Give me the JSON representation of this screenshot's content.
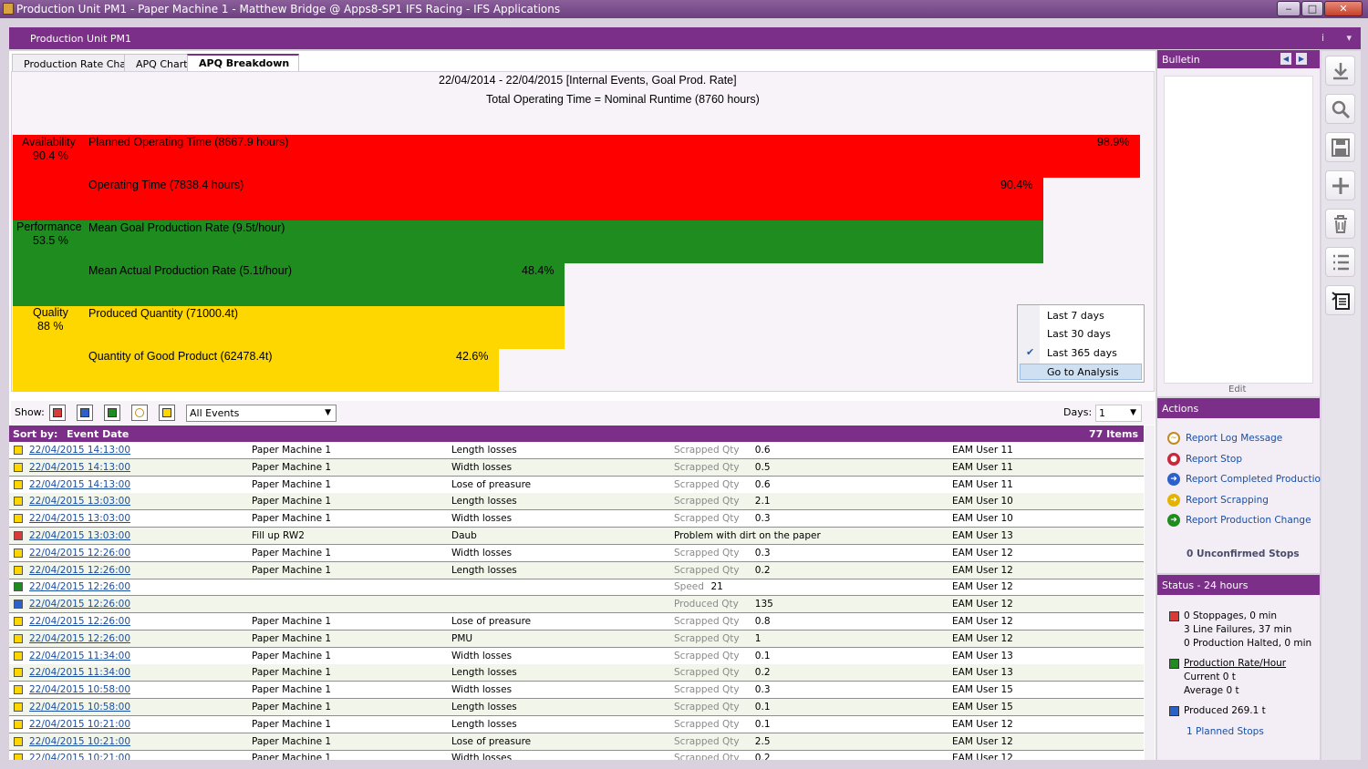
{
  "window": {
    "title": "Production Unit PM1 - Paper Machine 1 - Matthew Bridge @ Apps8-SP1 IFS Racing - IFS Applications",
    "min": "‒",
    "max": "□",
    "close": "✕"
  },
  "header": {
    "title": "Production Unit PM1",
    "info": "i",
    "pin": "▾"
  },
  "tabs": [
    {
      "label": "Production Rate Chart"
    },
    {
      "label": "APQ Chart"
    },
    {
      "label": "APQ Breakdown"
    }
  ],
  "apq": {
    "period": "22/04/2014 - 22/04/2015 [Internal Events, Goal Prod. Rate]",
    "total": "Total Operating Time = Nominal Runtime (8760 hours)",
    "availability_label": "Availability",
    "availability_pct": "90.4 %",
    "performance_label": "Performance",
    "performance_pct": "53.5 %",
    "quality_label": "Quality",
    "quality_pct": "88 %",
    "bars": [
      {
        "label": "Planned Operating Time (8667.9 hours)",
        "pct": "98.9%",
        "fraction": 0.989
      },
      {
        "label": "Operating Time (7838.4 hours)",
        "pct": "90.4%",
        "fraction": 0.904
      },
      {
        "label": "Mean Goal Production Rate (9.5t/hour)",
        "pct": "",
        "fraction": 0.904
      },
      {
        "label": "Mean Actual Production Rate (5.1t/hour)",
        "pct": "48.4%",
        "fraction": 0.484
      },
      {
        "label": "Produced Quantity (71000.4t)",
        "pct": "",
        "fraction": 0.484
      },
      {
        "label": "Quantity of Good Product (62478.4t)",
        "pct": "42.6%",
        "fraction": 0.426
      }
    ],
    "colors": {
      "availability": "#ff0000",
      "performance": "#1e8c1e",
      "quality": "#ffd700"
    }
  },
  "menu": {
    "items": [
      "Last 7 days",
      "Last 30 days",
      "Last 365 days",
      "Go to Analysis"
    ],
    "checked": "✔"
  },
  "filter": {
    "show_label": "Show:",
    "events_value": "All Events",
    "days_label": "Days:",
    "days_value": "1",
    "arrow": "▼"
  },
  "grid": {
    "sort_label": "Sort by:",
    "sort_field": "Event Date",
    "count": "77 Items",
    "rows": [
      {
        "color": "#ffd700",
        "date": "22/04/2015 14:13:00",
        "unit": "Paper Machine 1",
        "reason": "Length losses",
        "qty_label": "Scrapped Qty",
        "qty": "0.6",
        "user": "EAM User 11"
      },
      {
        "color": "#ffd700",
        "date": "22/04/2015 14:13:00",
        "unit": "Paper Machine 1",
        "reason": "Width losses",
        "qty_label": "Scrapped Qty",
        "qty": "0.5",
        "user": "EAM User 11"
      },
      {
        "color": "#ffd700",
        "date": "22/04/2015 14:13:00",
        "unit": "Paper Machine 1",
        "reason": "Lose of preasure",
        "qty_label": "Scrapped Qty",
        "qty": "0.6",
        "user": "EAM User 11"
      },
      {
        "color": "#ffd700",
        "date": "22/04/2015 13:03:00",
        "unit": "Paper Machine 1",
        "reason": "Length losses",
        "qty_label": "Scrapped Qty",
        "qty": "2.1",
        "user": "EAM User 10"
      },
      {
        "color": "#ffd700",
        "date": "22/04/2015 13:03:00",
        "unit": "Paper Machine 1",
        "reason": "Width losses",
        "qty_label": "Scrapped Qty",
        "qty": "0.3",
        "user": "EAM User 10"
      },
      {
        "color": "#d93a3a",
        "date": "22/04/2015 13:03:00",
        "unit": "Fill up RW2",
        "reason": "Daub",
        "qty_label": "",
        "qty": "Problem with dirt on the paper",
        "user": "EAM User 13"
      },
      {
        "color": "#ffd700",
        "date": "22/04/2015 12:26:00",
        "unit": "Paper Machine 1",
        "reason": "Width losses",
        "qty_label": "Scrapped Qty",
        "qty": "0.3",
        "user": "EAM User 12"
      },
      {
        "color": "#ffd700",
        "date": "22/04/2015 12:26:00",
        "unit": "Paper Machine 1",
        "reason": "Length losses",
        "qty_label": "Scrapped Qty",
        "qty": "0.2",
        "user": "EAM User 12"
      },
      {
        "color": "#1e8c1e",
        "date": "22/04/2015 12:26:00",
        "unit": "",
        "reason": "",
        "qty_label": "Speed",
        "qty": "21",
        "user": "EAM User 12"
      },
      {
        "color": "#2a62c9",
        "date": "22/04/2015 12:26:00",
        "unit": "",
        "reason": "",
        "qty_label": "Produced Qty",
        "qty": "135",
        "user": "EAM User 12"
      },
      {
        "color": "#ffd700",
        "date": "22/04/2015 12:26:00",
        "unit": "Paper Machine 1",
        "reason": "Lose of preasure",
        "qty_label": "Scrapped Qty",
        "qty": "0.8",
        "user": "EAM User 12"
      },
      {
        "color": "#ffd700",
        "date": "22/04/2015 12:26:00",
        "unit": "Paper Machine 1",
        "reason": "PMU",
        "qty_label": "Scrapped Qty",
        "qty": "1",
        "user": "EAM User 12"
      },
      {
        "color": "#ffd700",
        "date": "22/04/2015 11:34:00",
        "unit": "Paper Machine 1",
        "reason": "Width losses",
        "qty_label": "Scrapped Qty",
        "qty": "0.1",
        "user": "EAM User 13"
      },
      {
        "color": "#ffd700",
        "date": "22/04/2015 11:34:00",
        "unit": "Paper Machine 1",
        "reason": "Length losses",
        "qty_label": "Scrapped Qty",
        "qty": "0.2",
        "user": "EAM User 13"
      },
      {
        "color": "#ffd700",
        "date": "22/04/2015 10:58:00",
        "unit": "Paper Machine 1",
        "reason": "Width losses",
        "qty_label": "Scrapped Qty",
        "qty": "0.3",
        "user": "EAM User 15"
      },
      {
        "color": "#ffd700",
        "date": "22/04/2015 10:58:00",
        "unit": "Paper Machine 1",
        "reason": "Length losses",
        "qty_label": "Scrapped Qty",
        "qty": "0.1",
        "user": "EAM User 15"
      },
      {
        "color": "#ffd700",
        "date": "22/04/2015 10:21:00",
        "unit": "Paper Machine 1",
        "reason": "Length losses",
        "qty_label": "Scrapped Qty",
        "qty": "0.1",
        "user": "EAM User 12"
      },
      {
        "color": "#ffd700",
        "date": "22/04/2015 10:21:00",
        "unit": "Paper Machine 1",
        "reason": "Lose of preasure",
        "qty_label": "Scrapped Qty",
        "qty": "2.5",
        "user": "EAM User 12"
      },
      {
        "color": "#ffd700",
        "date": "22/04/2015 10:21:00",
        "unit": "Paper Machine 1",
        "reason": "Width losses",
        "qty_label": "Scrapped Qty",
        "qty": "0.2",
        "user": "EAM User 12"
      }
    ]
  },
  "bulletin": {
    "title": "Bulletin",
    "edit": "Edit",
    "prev": "◀",
    "next": "▶"
  },
  "actions": {
    "title": "Actions",
    "items": [
      {
        "label": "Report Log Message",
        "icon": "log-icon",
        "color": "#ffffff"
      },
      {
        "label": "Report Stop",
        "icon": "stop-icon",
        "color": "#c8283c"
      },
      {
        "label": "Report Completed Production",
        "icon": "arrow-icon",
        "color": "#2a62c9"
      },
      {
        "label": "Report Scrapping",
        "icon": "arrow-icon",
        "color": "#e2b400"
      },
      {
        "label": "Report Production Change",
        "icon": "arrow-icon",
        "color": "#1e8c1e"
      }
    ],
    "unconfirmed": "0 Unconfirmed Stops"
  },
  "status": {
    "title": "Status - 24 hours",
    "stoppages": "0 Stoppages, 0 min",
    "line_failures": "3 Line Failures, 37 min",
    "halted": "0 Production Halted, 0 min",
    "rate_link": "Production Rate/Hour",
    "current": "Current 0 t",
    "average": "Average 0 t",
    "produced": "Produced 269.1 t",
    "planned": "1 Planned Stops"
  },
  "toolbar": [
    "download-icon",
    "search-icon",
    "save-icon",
    "add-icon",
    "delete-icon",
    "list-icon",
    "details-icon"
  ]
}
